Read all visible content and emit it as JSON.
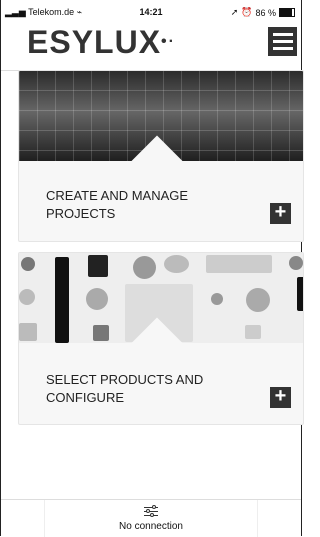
{
  "status": {
    "carrier": "Telekom.de",
    "time": "14:21",
    "battery": "86 %",
    "signal_icon": "signal-icon",
    "wifi_icon": "wifi-icon",
    "location_icon": "location-icon",
    "alarm_icon": "alarm-icon"
  },
  "header": {
    "logo": "ESYLUX",
    "logo_dots": "•·",
    "menu_icon": "hamburger-menu-icon"
  },
  "cards": [
    {
      "title_line1": "CREATE AND MANAGE",
      "title_line2": "PROJECTS",
      "plus": "+"
    },
    {
      "title_line1": "SELECT PRODUCTS AND",
      "title_line2": "CONFIGURE",
      "plus": "+"
    }
  ],
  "footer": {
    "status": "No connection",
    "icon": "settings-sliders-icon"
  }
}
